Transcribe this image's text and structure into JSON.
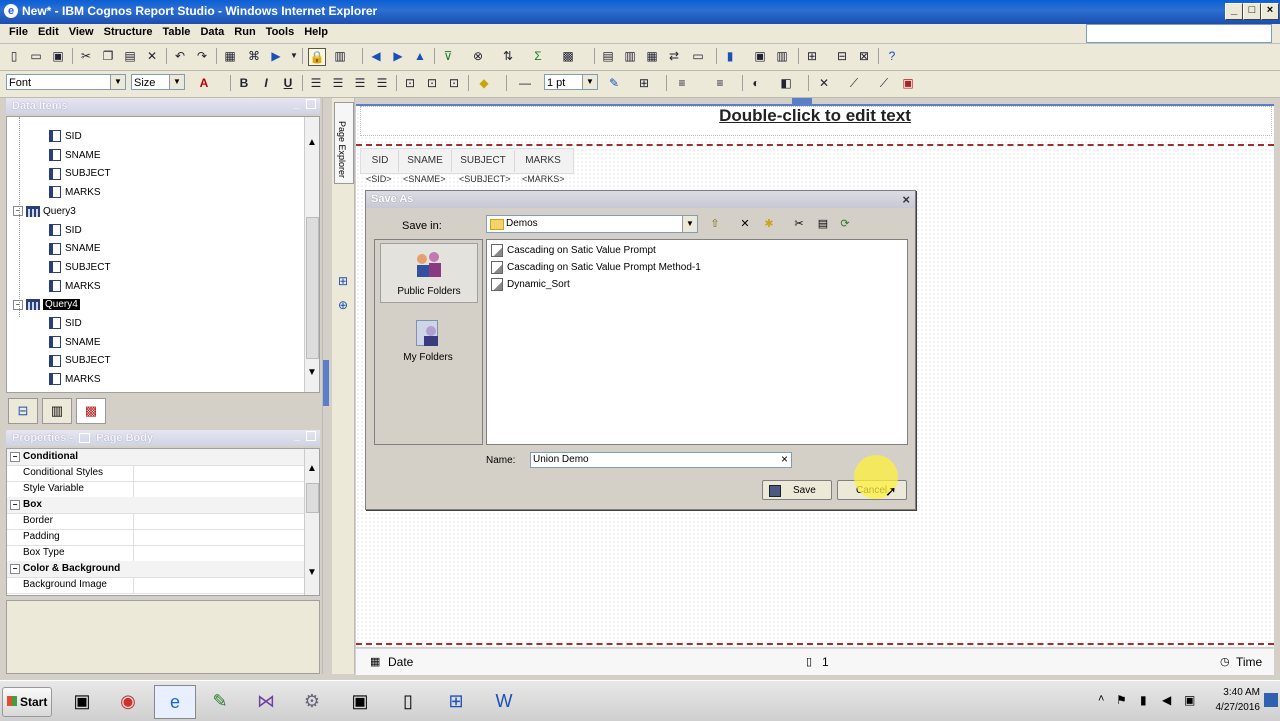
{
  "window": {
    "title": "New* - IBM Cognos Report Studio - Windows Internet Explorer"
  },
  "menu": [
    "File",
    "Edit",
    "View",
    "Structure",
    "Table",
    "Data",
    "Run",
    "Tools",
    "Help"
  ],
  "format_toolbar": {
    "font_placeholder": "Font",
    "size_placeholder": "Size",
    "line_width": "1 pt"
  },
  "data_items": {
    "title": "Data Items",
    "rows": [
      {
        "label": "SID",
        "type": "item",
        "level": 2
      },
      {
        "label": "SNAME",
        "type": "item",
        "level": 2
      },
      {
        "label": "SUBJECT",
        "type": "item",
        "level": 2
      },
      {
        "label": "MARKS",
        "type": "item",
        "level": 2
      },
      {
        "label": "Query3",
        "type": "query",
        "level": 1
      },
      {
        "label": "SID",
        "type": "item",
        "level": 2
      },
      {
        "label": "SNAME",
        "type": "item",
        "level": 2
      },
      {
        "label": "SUBJECT",
        "type": "item",
        "level": 2
      },
      {
        "label": "MARKS",
        "type": "item",
        "level": 2
      },
      {
        "label": "Query4",
        "type": "query",
        "level": 1,
        "selected": true
      },
      {
        "label": "SID",
        "type": "item",
        "level": 2
      },
      {
        "label": "SNAME",
        "type": "item",
        "level": 2
      },
      {
        "label": "SUBJECT",
        "type": "item",
        "level": 2
      },
      {
        "label": "MARKS",
        "type": "item",
        "level": 2
      }
    ]
  },
  "properties": {
    "title": "Properties - ",
    "context": "Page Body",
    "rows": [
      {
        "label": "Conditional",
        "group": true
      },
      {
        "label": "Conditional Styles"
      },
      {
        "label": "Style Variable"
      },
      {
        "label": "Box",
        "group": true
      },
      {
        "label": "Border"
      },
      {
        "label": "Padding"
      },
      {
        "label": "Box Type"
      },
      {
        "label": "Color & Background",
        "group": true
      },
      {
        "label": "Background Image"
      }
    ]
  },
  "side_tab": {
    "page_explorer": "Page Explorer"
  },
  "canvas": {
    "header_text": "Double-click to edit text",
    "columns": [
      "SID",
      "SNAME",
      "SUBJECT",
      "MARKS"
    ],
    "values": [
      "<SID>",
      "<SNAME>",
      "<SUBJECT>",
      "<MARKS>"
    ],
    "footer_left": "Date",
    "footer_page": "1",
    "footer_right": "Time"
  },
  "save_dialog": {
    "title": "Save As",
    "save_in_label": "Save in:",
    "save_in_value": "Demos",
    "places": [
      {
        "label": "Public Folders",
        "selected": true
      },
      {
        "label": "My Folders"
      }
    ],
    "files": [
      "Cascading on Satic Value Prompt",
      "Cascading on Satic Value Prompt Method-1",
      "Dynamic_Sort"
    ],
    "name_label": "Name:",
    "name_value": "Union Demo",
    "save_button": "Save",
    "cancel_button": "Cancel"
  },
  "taskbar": {
    "start_label": "Start",
    "clock_time": "3:40 AM",
    "clock_date": "4/27/2016"
  },
  "colors": {
    "title_blue": "#1a5fd6",
    "selected_bg": "#000000",
    "dialog_bg": "#d4d0c8",
    "border_red": "#a03030"
  }
}
